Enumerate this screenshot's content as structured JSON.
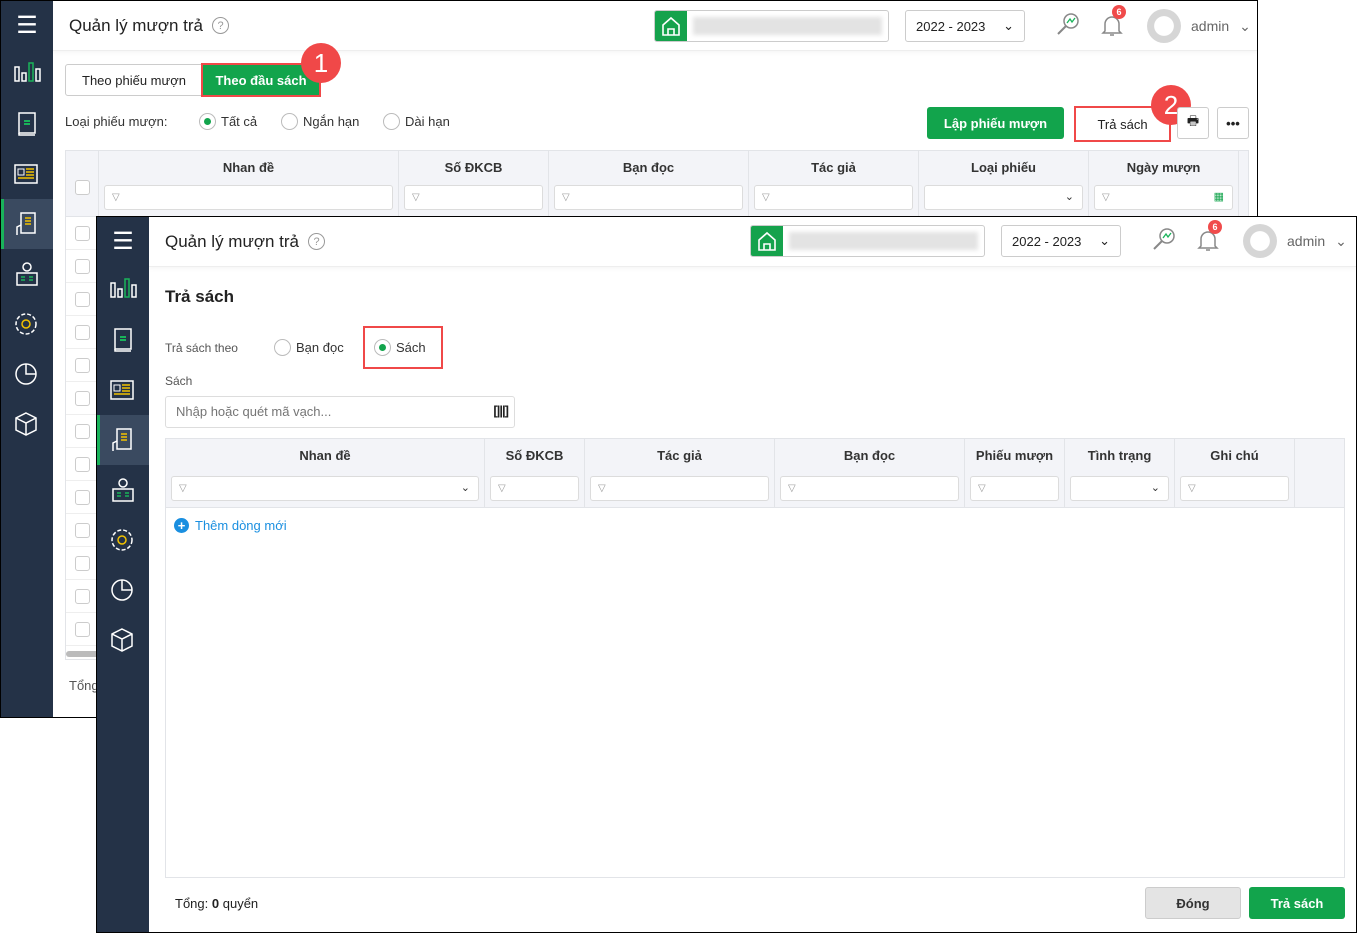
{
  "back": {
    "title": "Quản lý mượn trả",
    "year": "2022 - 2023",
    "notifications": "6",
    "user": "admin",
    "tabs": [
      {
        "label": "Theo phiếu mượn",
        "active": false
      },
      {
        "label": "Theo đầu sách",
        "active": true
      }
    ],
    "filter_label": "Loại phiếu mượn:",
    "filter_options": [
      {
        "label": "Tất cả",
        "checked": true
      },
      {
        "label": "Ngắn hạn",
        "checked": false
      },
      {
        "label": "Dài hạn",
        "checked": false
      }
    ],
    "create_button": "Lập phiếu mượn",
    "return_button": "Trả sách",
    "columns": [
      "Nhan đề",
      "Số ĐKCB",
      "Bạn đọc",
      "Tác giả",
      "Loại phiếu",
      "Ngày mượn"
    ],
    "total_label": "Tổng"
  },
  "callouts": [
    "1",
    "2"
  ],
  "front": {
    "title": "Quản lý mượn trả",
    "year": "2022 - 2023",
    "notifications": "6",
    "user": "admin",
    "heading": "Trả sách",
    "mode_label": "Trả sách theo",
    "mode_options": [
      {
        "label": "Bạn đọc",
        "checked": false
      },
      {
        "label": "Sách",
        "checked": true
      }
    ],
    "book_label": "Sách",
    "book_placeholder": "Nhập hoặc quét mã vạch...",
    "columns": [
      "Nhan đề",
      "Số ĐKCB",
      "Tác giả",
      "Bạn đọc",
      "Phiếu mượn",
      "Tình trạng",
      "Ghi chú"
    ],
    "add_row": "Thêm dòng mới",
    "total_prefix": "Tổng:",
    "total_count": "0",
    "total_unit": "quyển",
    "close_button": "Đóng",
    "return_button": "Trả sách"
  },
  "colors": {
    "brand": "#12a44c",
    "sidebar": "#243247",
    "callout": "#f04848",
    "link": "#1a8fe0"
  }
}
